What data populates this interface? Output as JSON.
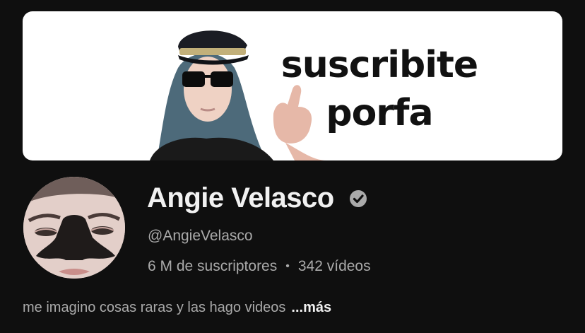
{
  "banner": {
    "line1": "suscribite",
    "line2": "porfa"
  },
  "channel": {
    "name": "Angie Velasco",
    "verified_icon": "verified-check-icon",
    "handle": "@AngieVelasco",
    "subscribers": "6 M de suscriptores",
    "separator": "•",
    "videos": "342 vídeos",
    "description": "me imagino cosas raras y las hago videos",
    "more_label": "...más"
  },
  "colors": {
    "background": "#0f0f0f",
    "primary_text": "#f1f1f1",
    "secondary_text": "#aaaaaa",
    "banner_bg": "#ffffff"
  }
}
